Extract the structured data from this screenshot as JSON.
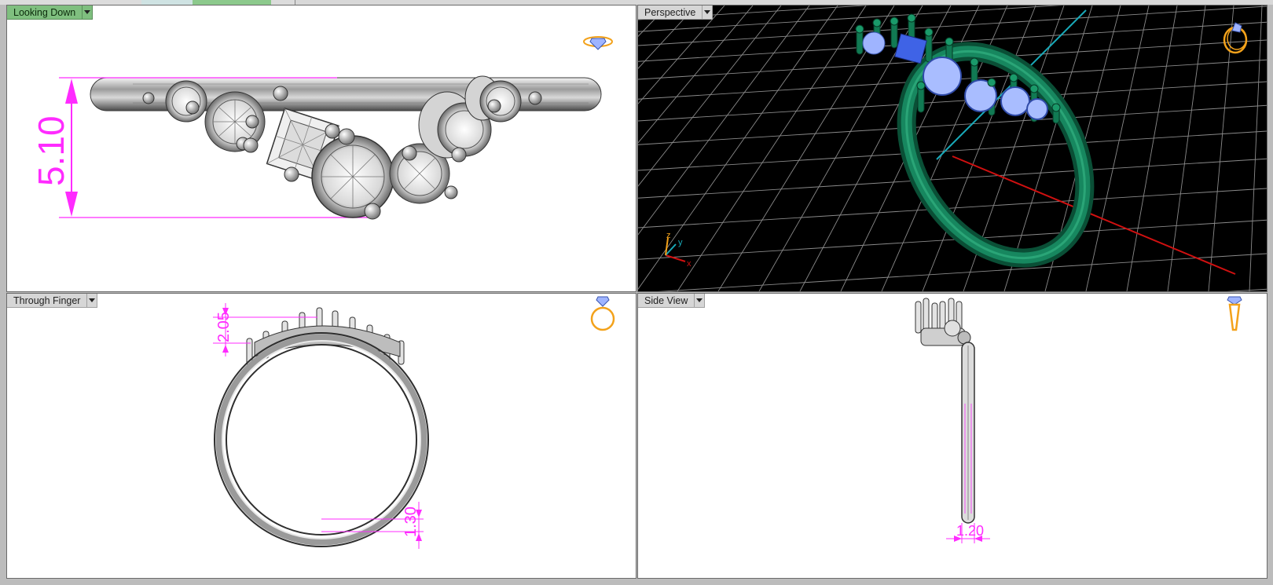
{
  "tabs": [
    {
      "label": ""
    },
    {
      "label": ""
    },
    {
      "label": ""
    },
    {
      "label": ""
    },
    {
      "label": ""
    }
  ],
  "viewports": {
    "top_left": {
      "title": "Looking Down",
      "active": true,
      "dimension": "5.10"
    },
    "top_right": {
      "title": "Perspective",
      "active": false,
      "axes": {
        "x": "x",
        "y": "y",
        "z": "z"
      }
    },
    "bottom_left": {
      "title": "Through Finger",
      "active": false,
      "dimension_top": "2.05",
      "dimension_bottom": "1.30"
    },
    "bottom_right": {
      "title": "Side View",
      "active": false,
      "dimension": "1.20"
    }
  },
  "colors": {
    "accent_active": "#7fbf7f",
    "dimension": "#ff2bff",
    "perspective_bg": "#000000",
    "grid": "#8a8a8a",
    "ring_green": "#0e6b4a",
    "gem_blue": "#9fb4ff",
    "axis_x": "#d01010",
    "axis_y": "#19a9b8",
    "icon_orange": "#f3a21b"
  },
  "icons": [
    "diamond-ring-icon",
    "ring-perspective-icon",
    "ring-front-icon",
    "ring-side-icon",
    "dropdown-caret-icon"
  ]
}
